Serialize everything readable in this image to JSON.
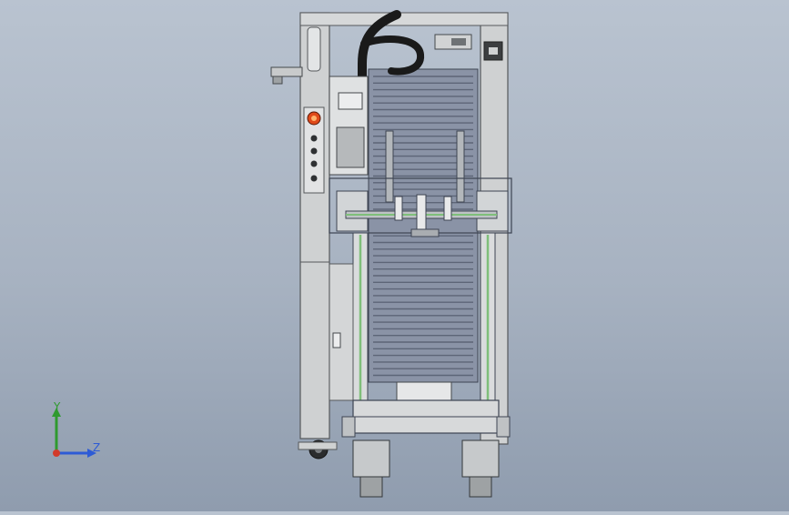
{
  "scene": {
    "view": "front",
    "background_top": "#b9c3d0",
    "background_bottom": "#8f9cae"
  },
  "triad": {
    "y_label": "Y",
    "z_label": "Z",
    "y_color": "#2f9a2f",
    "z_color": "#2d5bd6",
    "origin_color": "#d23a2a"
  },
  "machine_colors": {
    "frame": "#c9cbcc",
    "frame_dark": "#6e7275",
    "rail_green": "#7fbf7a",
    "magazine": "#8a93a6",
    "cable": "#1a1a1a",
    "estop": "#e04a1a"
  }
}
